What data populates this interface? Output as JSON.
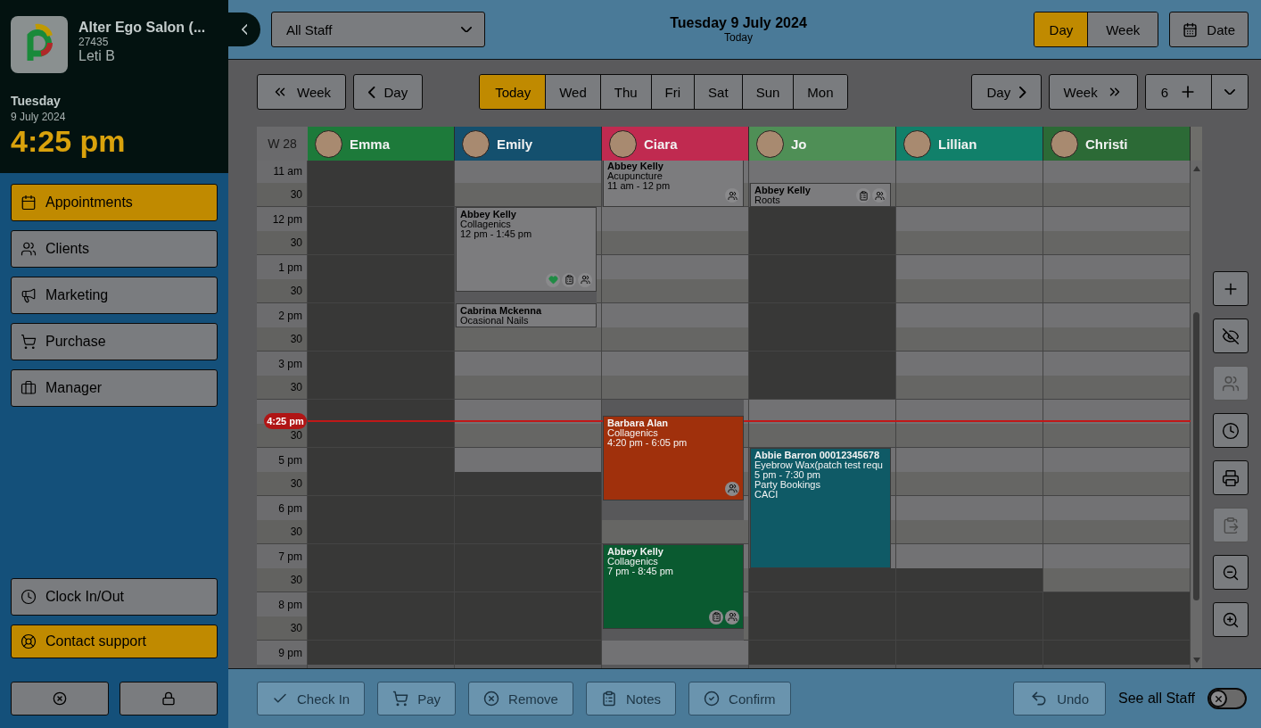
{
  "sidebar": {
    "salon": "Alter Ego Salon (...",
    "account": "27435",
    "user": "Leti B",
    "weekday": "Tuesday",
    "date": "9 July 2024",
    "time": "4:25 pm",
    "nav": [
      {
        "label": "Appointments",
        "selected": true
      },
      {
        "label": "Clients",
        "selected": false
      },
      {
        "label": "Marketing",
        "selected": false
      },
      {
        "label": "Purchase",
        "selected": false
      },
      {
        "label": "Manager",
        "selected": false
      }
    ],
    "clock": "Clock In/Out",
    "support": "Contact support"
  },
  "header": {
    "staff_filter": "All Staff",
    "title": "Tuesday 9 July 2024",
    "subtitle": "Today",
    "views": [
      {
        "label": "Day",
        "selected": true
      },
      {
        "label": "Week",
        "selected": false
      }
    ],
    "date_button": "Date"
  },
  "nav_bar": {
    "prev_week": "Week",
    "prev_day": "Day",
    "days": [
      {
        "label": "Today",
        "selected": true
      },
      {
        "label": "Wed",
        "selected": false
      },
      {
        "label": "Thu",
        "selected": false
      },
      {
        "label": "Fri",
        "selected": false
      },
      {
        "label": "Sat",
        "selected": false
      },
      {
        "label": "Sun",
        "selected": false
      },
      {
        "label": "Mon",
        "selected": false
      }
    ],
    "next_day": "Day",
    "next_week": "Week",
    "columns": "6"
  },
  "calendar": {
    "week": "W 28",
    "hours": [
      {
        "label": "11 am",
        "half": "30"
      },
      {
        "label": "12 pm",
        "half": "30"
      },
      {
        "label": "1 pm",
        "half": "30"
      },
      {
        "label": "2 pm",
        "half": "30"
      },
      {
        "label": "3 pm",
        "half": "30"
      },
      {
        "half": "30"
      },
      {
        "label": "5 pm",
        "half": "30"
      },
      {
        "label": "6 pm",
        "half": "30"
      },
      {
        "label": "7 pm",
        "half": "30"
      },
      {
        "label": "8 pm",
        "half": "30"
      },
      {
        "label": "9 pm"
      }
    ],
    "now": "4:25 pm",
    "staff": [
      {
        "name": "Emma",
        "color": "#1d7a3a",
        "slots": [
          {
            "available": false
          },
          {
            "available": false
          },
          {
            "available": false
          },
          {
            "available": false
          },
          {
            "available": false
          },
          {
            "available": false
          },
          {
            "available": false
          },
          {
            "available": false
          },
          {
            "available": false
          },
          {
            "available": false
          },
          {
            "available": false
          },
          {
            "available": false
          },
          {
            "available": false
          },
          {
            "available": false
          },
          {
            "available": false
          },
          {
            "available": false
          },
          {
            "available": false
          },
          {
            "available": false
          },
          {
            "available": false
          },
          {
            "available": false
          },
          {
            "available": false
          }
        ]
      },
      {
        "name": "Emily",
        "color": "#14506e",
        "slots": [
          {
            "available": true
          },
          {
            "available": true
          },
          {
            "available": true,
            "appointments": [
              {
                "client": "Abbey Kelly",
                "service": "Collagenics",
                "times": "12 pm - 1:45 pm",
                "badges": [
                  {
                    "kind": "favourite"
                  },
                  {
                    "kind": "notes"
                  },
                  {
                    "kind": "group"
                  }
                ]
              }
            ]
          },
          {
            "available": true
          },
          {
            "available": true
          },
          {
            "available": true
          },
          {
            "available": true,
            "appointments": [
              {
                "client": "Cabrina Mckenna",
                "service": "Ocasional Nails"
              }
            ]
          },
          {
            "available": true
          },
          {
            "available": true
          },
          {
            "available": true
          },
          {
            "available": true
          },
          {
            "available": true
          },
          {
            "available": true
          },
          {
            "available": false
          },
          {
            "available": false
          },
          {
            "available": false
          },
          {
            "available": false
          },
          {
            "available": false
          },
          {
            "available": false
          },
          {
            "available": false
          },
          {
            "available": false
          }
        ]
      },
      {
        "name": "Ciara",
        "color": "#c02a50",
        "slots": [
          {
            "available": true,
            "appointments": [
              {
                "client": "Abbey Kelly",
                "service": "Acupuncture",
                "times": "11 am - 12 pm",
                "badges": [
                  {
                    "kind": "group"
                  }
                ]
              }
            ]
          },
          {
            "available": true
          },
          {
            "available": true
          },
          {
            "available": true
          },
          {
            "available": true
          },
          {
            "available": true
          },
          {
            "available": true
          },
          {
            "available": true
          },
          {
            "available": true
          },
          {
            "available": true
          },
          {
            "available": true,
            "appointments": [
              {
                "client": "Barbara Alan",
                "service": "Collagenics",
                "times": "4:20 pm - 6:05 pm",
                "color": "#a0300c",
                "badges": [
                  {
                    "kind": "group"
                  }
                ]
              }
            ]
          },
          {
            "available": true
          },
          {
            "available": true
          },
          {
            "available": true
          },
          {
            "available": true
          },
          {
            "available": true
          },
          {
            "available": true,
            "appointments": [
              {
                "client": "Abbey Kelly",
                "service": "Collagenics",
                "times": "7 pm - 8:45 pm",
                "color": "#0a5a30",
                "badges": [
                  {
                    "kind": "notes"
                  },
                  {
                    "kind": "group"
                  }
                ]
              }
            ]
          },
          {
            "available": true
          },
          {
            "available": true
          },
          {
            "available": true
          },
          {
            "available": true
          }
        ]
      },
      {
        "name": "Jo",
        "color": "#4f8f56",
        "slots": [
          {
            "available": true
          },
          {
            "available": true,
            "appointments": [
              {
                "client": "Abbey Kelly",
                "service": "Roots",
                "badges": [
                  {
                    "kind": "notes"
                  },
                  {
                    "kind": "group"
                  }
                ]
              }
            ]
          },
          {
            "available": false
          },
          {
            "available": false
          },
          {
            "available": false
          },
          {
            "available": false
          },
          {
            "available": false
          },
          {
            "available": false
          },
          {
            "available": false
          },
          {
            "available": false
          },
          {
            "available": true
          },
          {
            "available": true
          },
          {
            "available": true,
            "appointments": [
              {
                "client": "Abbie Barron  00012345678",
                "service": "Eyebrow Wax(patch test requ",
                "times": "5 pm - 7:30 pm",
                "notes": [
                  "Party Bookings",
                  "CACI"
                ],
                "color": "#0f5a66"
              }
            ]
          },
          {
            "available": true
          },
          {
            "available": true
          },
          {
            "available": true
          },
          {
            "available": true
          },
          {
            "available": false
          },
          {
            "available": false
          },
          {
            "available": false
          },
          {
            "available": false
          }
        ]
      },
      {
        "name": "Lillian",
        "color": "#11806a",
        "slots": [
          {
            "available": true
          },
          {
            "available": true
          },
          {
            "available": true
          },
          {
            "available": true
          },
          {
            "available": true
          },
          {
            "available": true
          },
          {
            "available": true
          },
          {
            "available": true
          },
          {
            "available": true
          },
          {
            "available": true
          },
          {
            "available": true
          },
          {
            "available": true
          },
          {
            "available": true
          },
          {
            "available": true
          },
          {
            "available": true
          },
          {
            "available": true
          },
          {
            "available": true
          },
          {
            "available": false
          },
          {
            "available": false
          },
          {
            "available": false
          },
          {
            "available": false
          }
        ]
      },
      {
        "name": "Christi",
        "color": "#2c6a36",
        "slots": [
          {
            "available": true
          },
          {
            "available": true
          },
          {
            "available": true
          },
          {
            "available": true
          },
          {
            "available": true
          },
          {
            "available": true
          },
          {
            "available": true
          },
          {
            "available": true
          },
          {
            "available": true
          },
          {
            "available": true
          },
          {
            "available": true
          },
          {
            "available": true
          },
          {
            "available": true
          },
          {
            "available": true
          },
          {
            "available": true
          },
          {
            "available": true
          },
          {
            "available": true
          },
          {
            "available": true
          },
          {
            "available": false
          },
          {
            "available": false
          },
          {
            "available": false
          }
        ]
      }
    ]
  },
  "tools": [
    {
      "kind": "add",
      "disabled": false
    },
    {
      "kind": "hide",
      "disabled": false
    },
    {
      "kind": "group",
      "disabled": true
    },
    {
      "kind": "clock",
      "disabled": false
    },
    {
      "kind": "print",
      "disabled": false
    },
    {
      "kind": "paste",
      "disabled": true
    },
    {
      "kind": "zoom_out",
      "disabled": false
    },
    {
      "kind": "zoom_in",
      "disabled": false
    }
  ],
  "actions": [
    {
      "kind": "check",
      "label": "Check In",
      "disabled": true
    },
    {
      "kind": "pay",
      "label": "Pay",
      "disabled": true
    },
    {
      "kind": "remove",
      "label": "Remove",
      "disabled": true
    },
    {
      "kind": "notes",
      "label": "Notes",
      "disabled": true
    },
    {
      "kind": "confirm",
      "label": "Confirm",
      "disabled": true
    }
  ],
  "undo": {
    "label": "Undo",
    "disabled": true
  },
  "see_all": {
    "label": "See all Staff",
    "on": false
  }
}
